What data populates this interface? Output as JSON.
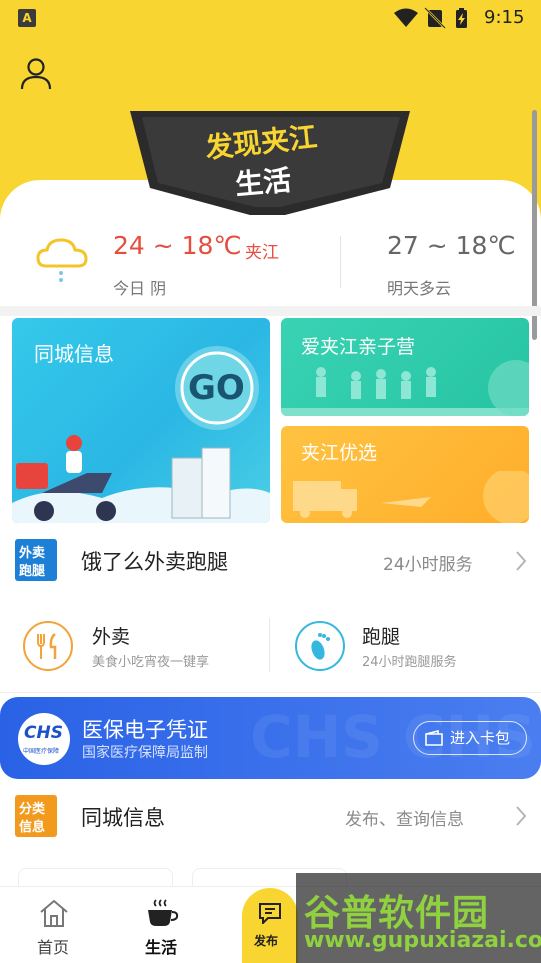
{
  "status_bar": {
    "time": "9:15",
    "app_icon_letter": "A"
  },
  "header": {
    "banner_line1": "发现夹江",
    "banner_line2": "生活"
  },
  "weather": {
    "today_temp": "24 ~ 18℃",
    "city": "夹江",
    "today_desc": "今日 阴",
    "tomorrow_temp": "27 ~ 18℃",
    "tomorrow_desc": "明天多云"
  },
  "cards": {
    "tongcheng": {
      "title": "同城信息",
      "go_label": "GO"
    },
    "qinzi": {
      "title": "爱夹江亲子营"
    },
    "youxuan": {
      "title": "夹江优选"
    }
  },
  "takeout_section": {
    "badge_line1": "外卖",
    "badge_line2": "跑腿",
    "title": "饿了么外卖跑腿",
    "right_text": "24小时服务",
    "items": [
      {
        "title": "外卖",
        "subtitle": "美食小吃宵夜一键享"
      },
      {
        "title": "跑腿",
        "subtitle": "24小时跑腿服务"
      }
    ]
  },
  "chs_banner": {
    "logo_text": "CHS",
    "logo_sub": "中国医疗保障",
    "title": "医保电子凭证",
    "subtitle": "国家医疗保障局监制",
    "button_label": "进入卡包"
  },
  "info_section": {
    "badge_line1": "分类",
    "badge_line2": "信息",
    "title": "同城信息",
    "right_text": "发布、查询信息"
  },
  "bottom_nav": {
    "items": [
      {
        "label": "首页"
      },
      {
        "label": "生活"
      },
      {
        "label": "发布"
      }
    ]
  },
  "watermark": {
    "text": "谷普软件园",
    "url": "www.gupuxiazai.com"
  },
  "colors": {
    "brand_yellow": "#f8d530",
    "temp_red": "#e54d3e",
    "card_blue": "#35c9ea",
    "card_green": "#26c4a2",
    "card_orange": "#ffad2a",
    "chs_blue": "#2a62e6"
  }
}
